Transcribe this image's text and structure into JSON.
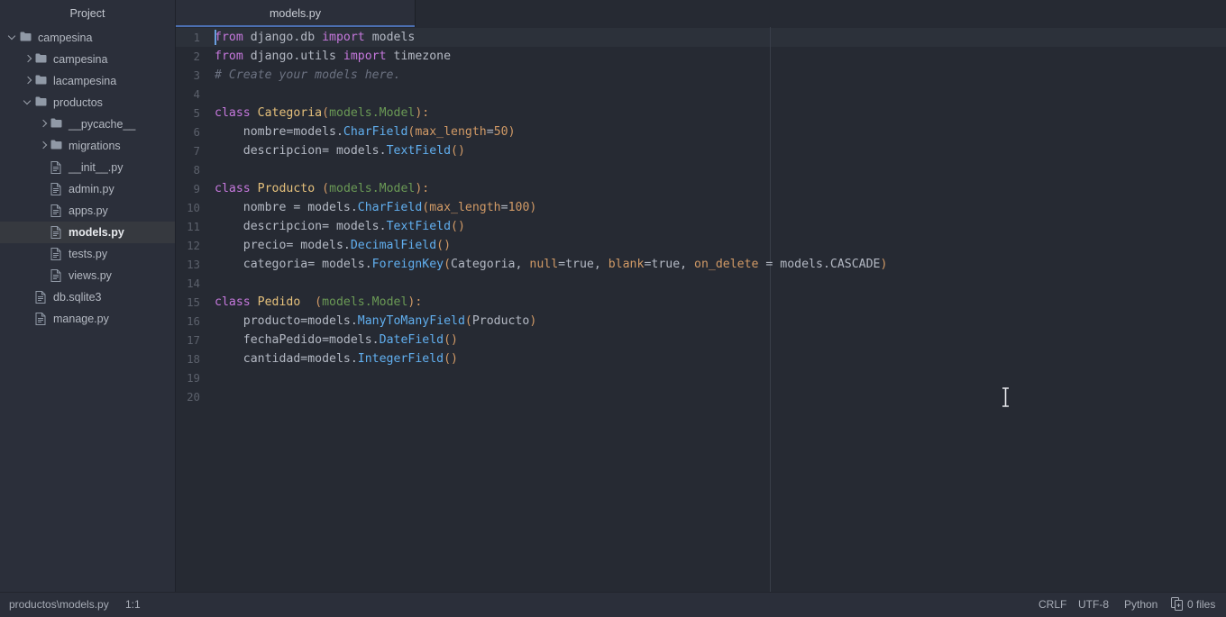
{
  "sidebar": {
    "header": "Project",
    "tree": [
      {
        "label": "campesina",
        "type": "folder",
        "indent": 0,
        "toggle": "down",
        "selected": false
      },
      {
        "label": "campesina",
        "type": "folder",
        "indent": 1,
        "toggle": "right",
        "selected": false
      },
      {
        "label": "lacampesina",
        "type": "folder",
        "indent": 1,
        "toggle": "right",
        "selected": false
      },
      {
        "label": "productos",
        "type": "folder",
        "indent": 1,
        "toggle": "down",
        "selected": false
      },
      {
        "label": "__pycache__",
        "type": "folder",
        "indent": 2,
        "toggle": "right",
        "selected": false
      },
      {
        "label": "migrations",
        "type": "folder",
        "indent": 2,
        "toggle": "right",
        "selected": false
      },
      {
        "label": "__init__.py",
        "type": "file",
        "indent": 2,
        "toggle": "none",
        "selected": false
      },
      {
        "label": "admin.py",
        "type": "file",
        "indent": 2,
        "toggle": "none",
        "selected": false
      },
      {
        "label": "apps.py",
        "type": "file",
        "indent": 2,
        "toggle": "none",
        "selected": false
      },
      {
        "label": "models.py",
        "type": "file",
        "indent": 2,
        "toggle": "none",
        "selected": true
      },
      {
        "label": "tests.py",
        "type": "file",
        "indent": 2,
        "toggle": "none",
        "selected": false
      },
      {
        "label": "views.py",
        "type": "file",
        "indent": 2,
        "toggle": "none",
        "selected": false
      },
      {
        "label": "db.sqlite3",
        "type": "file",
        "indent": 1,
        "toggle": "none",
        "selected": false
      },
      {
        "label": "manage.py",
        "type": "file",
        "indent": 1,
        "toggle": "none",
        "selected": false
      }
    ]
  },
  "tabs": {
    "active_label": "models.py"
  },
  "editor": {
    "language": "Python",
    "caret_line": 1,
    "lines": [
      {
        "no": "1",
        "tokens": [
          {
            "t": "from",
            "c": "k"
          },
          {
            "t": " django.db ",
            "c": "d"
          },
          {
            "t": "import",
            "c": "k"
          },
          {
            "t": " models",
            "c": "d"
          }
        ]
      },
      {
        "no": "2",
        "tokens": [
          {
            "t": "from",
            "c": "k"
          },
          {
            "t": " django.utils ",
            "c": "d"
          },
          {
            "t": "import",
            "c": "k"
          },
          {
            "t": " timezone",
            "c": "d"
          }
        ]
      },
      {
        "no": "3",
        "tokens": [
          {
            "t": "# Create your models here.",
            "c": "cm"
          }
        ]
      },
      {
        "no": "4",
        "tokens": []
      },
      {
        "no": "5",
        "tokens": [
          {
            "t": "class ",
            "c": "k"
          },
          {
            "t": "Categoria",
            "c": "cn"
          },
          {
            "t": "(",
            "c": "p"
          },
          {
            "t": "models.Model",
            "c": "g"
          },
          {
            "t": ")",
            "c": "p"
          },
          {
            "t": ":",
            "c": "p"
          }
        ]
      },
      {
        "no": "6",
        "tokens": [
          {
            "t": "    nombre=models.",
            "c": "d"
          },
          {
            "t": "CharField",
            "c": "f"
          },
          {
            "t": "(",
            "c": "p"
          },
          {
            "t": "max_length",
            "c": "kw"
          },
          {
            "t": "=",
            "c": "d"
          },
          {
            "t": "50",
            "c": "n"
          },
          {
            "t": ")",
            "c": "p"
          }
        ]
      },
      {
        "no": "7",
        "tokens": [
          {
            "t": "    descripcion= models.",
            "c": "d"
          },
          {
            "t": "TextField",
            "c": "f"
          },
          {
            "t": "()",
            "c": "p"
          }
        ]
      },
      {
        "no": "8",
        "tokens": []
      },
      {
        "no": "9",
        "tokens": [
          {
            "t": "class ",
            "c": "k"
          },
          {
            "t": "Producto",
            "c": "cn"
          },
          {
            "t": " (",
            "c": "p"
          },
          {
            "t": "models.Model",
            "c": "g"
          },
          {
            "t": ")",
            "c": "p"
          },
          {
            "t": ":",
            "c": "p"
          }
        ]
      },
      {
        "no": "10",
        "tokens": [
          {
            "t": "    nombre = models.",
            "c": "d"
          },
          {
            "t": "CharField",
            "c": "f"
          },
          {
            "t": "(",
            "c": "p"
          },
          {
            "t": "max_length",
            "c": "kw"
          },
          {
            "t": "=",
            "c": "d"
          },
          {
            "t": "100",
            "c": "n"
          },
          {
            "t": ")",
            "c": "p"
          }
        ]
      },
      {
        "no": "11",
        "tokens": [
          {
            "t": "    descripcion= models.",
            "c": "d"
          },
          {
            "t": "TextField",
            "c": "f"
          },
          {
            "t": "()",
            "c": "p"
          }
        ]
      },
      {
        "no": "12",
        "tokens": [
          {
            "t": "    precio= models.",
            "c": "d"
          },
          {
            "t": "DecimalField",
            "c": "f"
          },
          {
            "t": "()",
            "c": "p"
          }
        ]
      },
      {
        "no": "13",
        "tokens": [
          {
            "t": "    categoria= models.",
            "c": "d"
          },
          {
            "t": "ForeignKey",
            "c": "f"
          },
          {
            "t": "(",
            "c": "p"
          },
          {
            "t": "Categoria",
            "c": "d"
          },
          {
            "t": ", ",
            "c": "d"
          },
          {
            "t": "null",
            "c": "kw"
          },
          {
            "t": "=true, ",
            "c": "d"
          },
          {
            "t": "blank",
            "c": "kw"
          },
          {
            "t": "=true, ",
            "c": "d"
          },
          {
            "t": "on_delete",
            "c": "kw"
          },
          {
            "t": " = models.CASCADE",
            "c": "d"
          },
          {
            "t": ")",
            "c": "p"
          }
        ]
      },
      {
        "no": "14",
        "tokens": []
      },
      {
        "no": "15",
        "tokens": [
          {
            "t": "class ",
            "c": "k"
          },
          {
            "t": "Pedido",
            "c": "cn"
          },
          {
            "t": "  (",
            "c": "p"
          },
          {
            "t": "models.Model",
            "c": "g"
          },
          {
            "t": ")",
            "c": "p"
          },
          {
            "t": ":",
            "c": "p"
          }
        ]
      },
      {
        "no": "16",
        "tokens": [
          {
            "t": "    producto=models.",
            "c": "d"
          },
          {
            "t": "ManyToManyField",
            "c": "f"
          },
          {
            "t": "(",
            "c": "p"
          },
          {
            "t": "Producto",
            "c": "d"
          },
          {
            "t": ")",
            "c": "p"
          }
        ]
      },
      {
        "no": "17",
        "tokens": [
          {
            "t": "    fechaPedido=models.",
            "c": "d"
          },
          {
            "t": "DateField",
            "c": "f"
          },
          {
            "t": "()",
            "c": "p"
          }
        ]
      },
      {
        "no": "18",
        "tokens": [
          {
            "t": "    cantidad=models.",
            "c": "d"
          },
          {
            "t": "IntegerField",
            "c": "f"
          },
          {
            "t": "()",
            "c": "p"
          }
        ]
      },
      {
        "no": "19",
        "tokens": []
      },
      {
        "no": "20",
        "tokens": []
      }
    ]
  },
  "statusbar": {
    "file_path": "productos\\models.py",
    "caret_position": "1:1",
    "line_separator": "CRLF",
    "encoding": "UTF-8",
    "language": "Python",
    "vcs_changes": "0 files"
  },
  "colors": {
    "editor_bg": "#262a33",
    "panel_bg": "#2b2f3a",
    "selection_bg": "#36393f",
    "tab_underline": "#4b6eaf",
    "caret": "#6a9fe0",
    "keyword": "#c678dd",
    "class_name": "#e5c07b",
    "function": "#61afef",
    "kwarg": "#d19a66",
    "comment": "#6b7180",
    "text": "#b4b9c4"
  }
}
